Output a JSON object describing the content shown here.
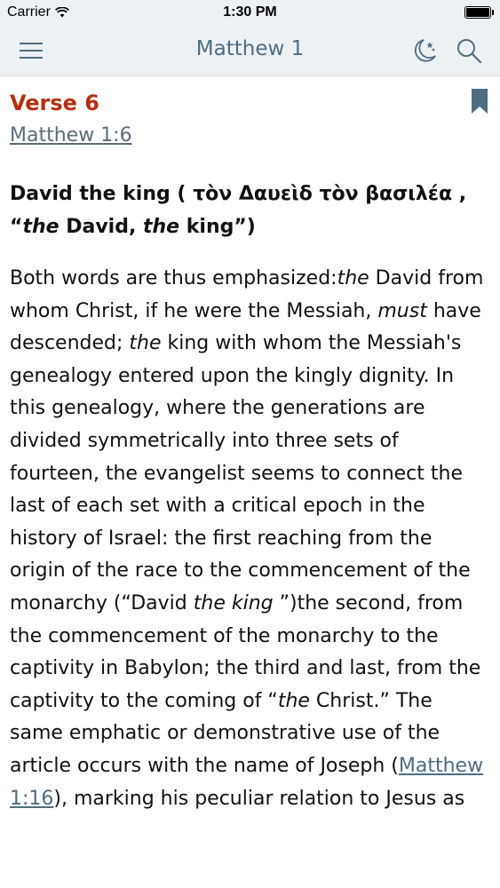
{
  "status_bar": {
    "carrier": "Carrier",
    "time": "1:30 PM",
    "wifi_icon": "wifi-icon",
    "battery_icon": "battery-icon"
  },
  "nav": {
    "title": "Matthew 1",
    "menu_icon": "hamburger-menu-icon",
    "night_mode_icon": "moon-stars-icon",
    "search_icon": "search-icon"
  },
  "verse": {
    "title": "Verse 6",
    "reference": "Matthew 1:6",
    "bookmark_icon": "bookmark-icon"
  },
  "heading": {
    "part1": "David the king ( τὸν Δαυεὶδ τὸν βασιλέα , “",
    "em1": "the",
    "part2": " David, ",
    "em2": "the",
    "part3": " king”)"
  },
  "body": {
    "t1": "Both words are thus emphasized:",
    "e1": "the",
    "t2": " David from whom Christ, if he were the Messiah, ",
    "e2": "must",
    "t3": " have descended; ",
    "e3": "the",
    "t4": " king with whom the Messiah's genealogy entered upon the kingly dignity. In this genealogy, where the generations are divided symmetrically into three sets of fourteen, the evangelist seems to connect the last of each set with a critical epoch in the history of Israel: the first reaching from the origin of the race to the commencement of the monarchy (“David ",
    "e4": "the king",
    "t5": " ”)the second, from the commencement of the monarchy to the captivity in Babylon; the third and last, from the captivity to the coming of “",
    "e5": "the",
    "t6": " Christ.” The same emphatic or demonstrative use of the article occurs with the name of Joseph (",
    "link1": "Matthew 1:16",
    "t7": "), marking his peculiar relation to Jesus as"
  },
  "colors": {
    "verse_title": "#b5300f",
    "nav_title": "#4f6d80",
    "icon": "#4f6d80",
    "bar_bg": "#eef1f4"
  }
}
